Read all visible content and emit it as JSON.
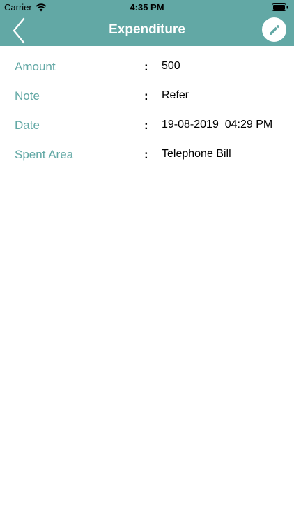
{
  "status_bar": {
    "carrier": "Carrier",
    "time": "4:35 PM"
  },
  "nav": {
    "title": "Expenditure",
    "back_icon": "chevron-left-icon",
    "edit_icon": "pencil-icon"
  },
  "colors": {
    "accent": "#62a8a5",
    "label": "#62a8a5",
    "value": "#000000"
  },
  "details": [
    {
      "label": "Amount",
      "separator": ":",
      "value": "500"
    },
    {
      "label": "Note",
      "separator": ":",
      "value": "Refer"
    },
    {
      "label": "Date",
      "separator": ":",
      "value": "19-08-2019  04:29 PM"
    },
    {
      "label": "Spent Area",
      "separator": ":",
      "value": "Telephone Bill"
    }
  ]
}
